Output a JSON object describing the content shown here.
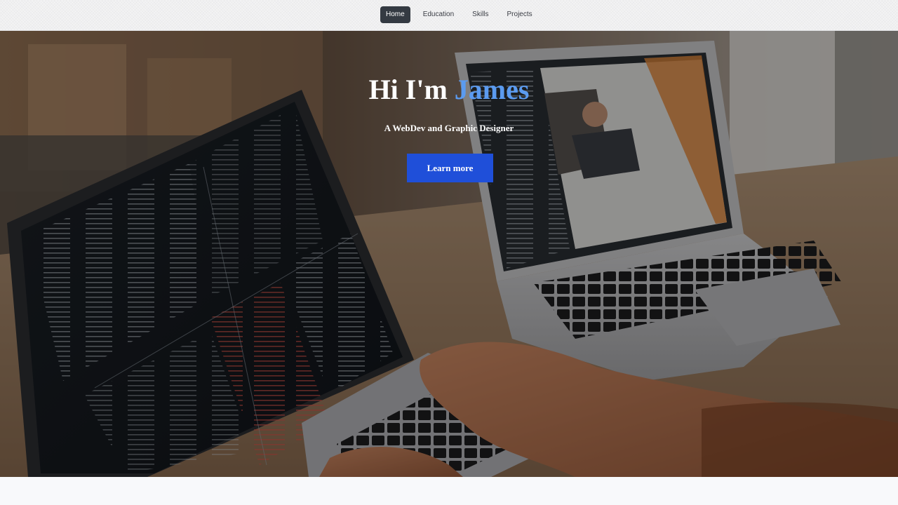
{
  "nav": {
    "items": [
      {
        "label": "Home",
        "active": true
      },
      {
        "label": "Education",
        "active": false
      },
      {
        "label": "Skills",
        "active": false
      },
      {
        "label": "Projects",
        "active": false
      }
    ]
  },
  "hero": {
    "title_prefix": "Hi I'm ",
    "title_name": "James",
    "subtitle": "A WebDev and Graphic Designer",
    "button_label": "Learn more",
    "background_image": "two-laptops-on-desk-photo"
  },
  "colors": {
    "accent_name": "#5b9bf0",
    "button": "#1f4fd9",
    "nav_active": "#343a42"
  }
}
